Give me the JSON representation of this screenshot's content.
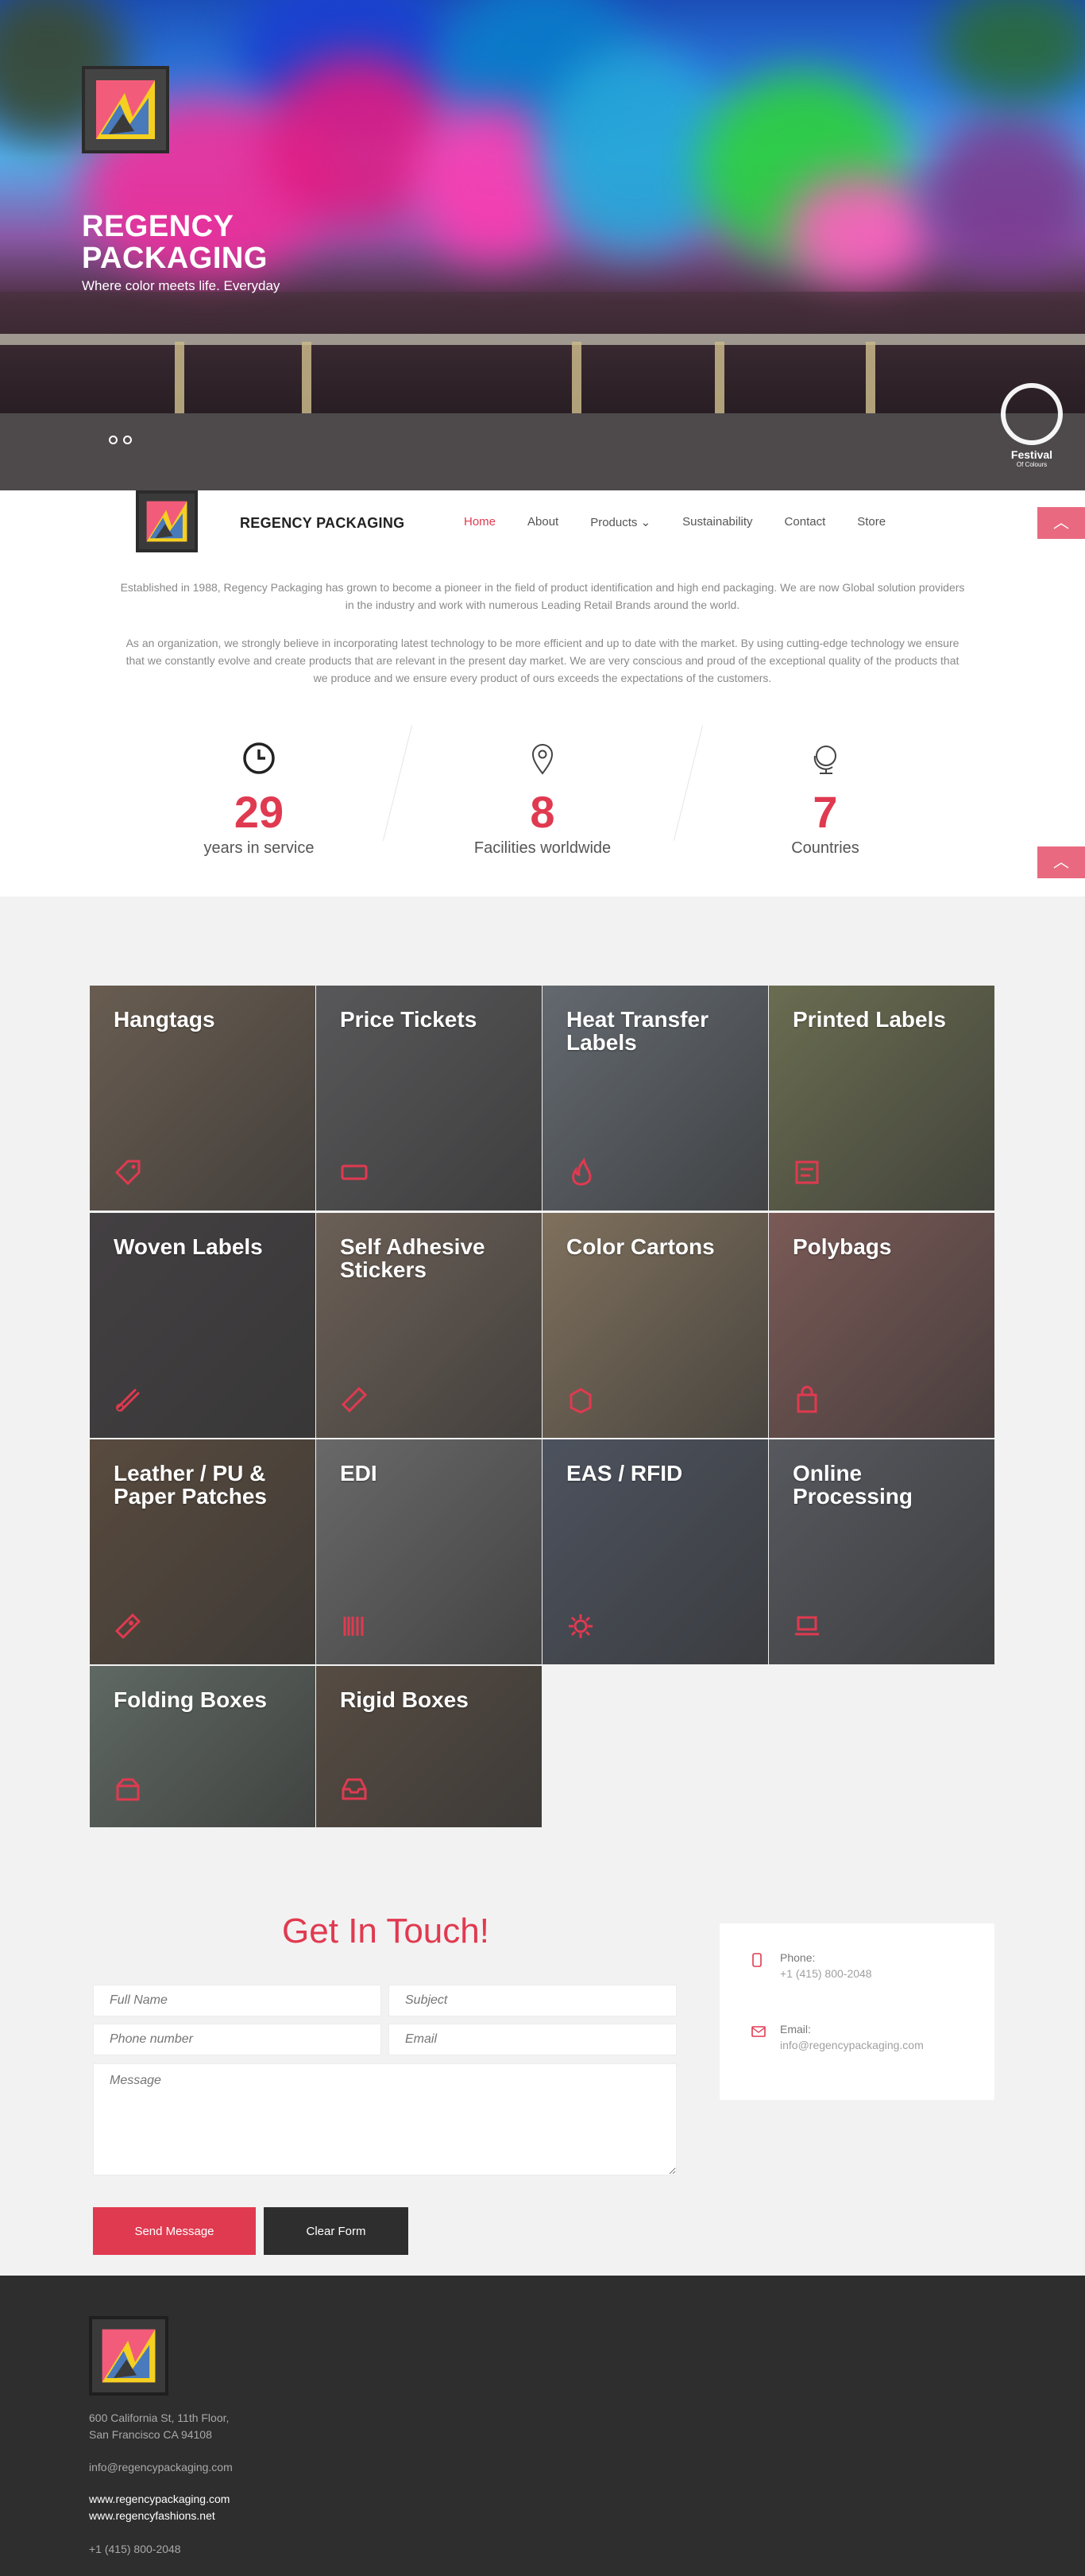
{
  "hero": {
    "title": "REGENCY PACKAGING",
    "subtitle": "Where color meets life. Everyday",
    "festival_title": "Festival",
    "festival_sub": "Of Colours"
  },
  "nav": {
    "brand": "REGENCY PACKAGING",
    "items": [
      {
        "label": "Home",
        "active": true
      },
      {
        "label": "About"
      },
      {
        "label": "Products ⌄"
      },
      {
        "label": "Sustainability"
      },
      {
        "label": "Contact"
      },
      {
        "label": "Store"
      }
    ]
  },
  "about": {
    "p1": "Established in 1988, Regency Packaging has grown to become a pioneer in the field of product identification and high end packaging. We are now Global solution providers in the industry and work with numerous Leading Retail Brands around the world.",
    "p2": "As an organization, we strongly believe in incorporating latest technology to be more efficient and up to date with the market. By using cutting-edge technology we ensure that we constantly evolve and create products that are relevant in the present day market. We are very conscious and proud of the exceptional quality of the products that we produce and we ensure every product of ours exceeds the expectations of the customers."
  },
  "stats": [
    {
      "icon": "clock-icon",
      "value": "29",
      "label": "years in service"
    },
    {
      "icon": "location-pin-icon",
      "value": "8",
      "label": "Facilities worldwide"
    },
    {
      "icon": "globe-icon",
      "value": "7",
      "label": "Countries"
    }
  ],
  "products": [
    {
      "title": "Hangtags",
      "icon": "tag-icon",
      "color": "#8a7560"
    },
    {
      "title": "Price Tickets",
      "icon": "ticket-icon",
      "color": "#6d6d70"
    },
    {
      "title": "Heat Transfer Labels",
      "icon": "fire-icon",
      "color": "#7f8a95"
    },
    {
      "title": "Printed Labels",
      "icon": "label-icon",
      "color": "#8c9160"
    },
    {
      "title": "Woven Labels",
      "icon": "thread-icon",
      "color": "#4a4448"
    },
    {
      "title": "Self Adhesive Stickers",
      "icon": "sticker-icon",
      "color": "#8e7a6a"
    },
    {
      "title": "Color Cartons",
      "icon": "box-icon",
      "color": "#b09775"
    },
    {
      "title": "Polybags",
      "icon": "bag-icon",
      "color": "#a8706a"
    },
    {
      "title": "Leather / PU & Paper Patches",
      "icon": "patch-icon",
      "color": "#6e5640"
    },
    {
      "title": "EDI",
      "icon": "barcode-icon",
      "color": "#8a8a8a"
    },
    {
      "title": "EAS / RFID",
      "icon": "gear-icon",
      "color": "#5a6478"
    },
    {
      "title": "Online Processing",
      "icon": "laptop-icon",
      "color": "#6a6e78"
    },
    {
      "title": "Folding Boxes",
      "icon": "box-open-icon",
      "color": "#7a8a80"
    },
    {
      "title": "Rigid Boxes",
      "icon": "tray-icon",
      "color": "#6a5848"
    }
  ],
  "contact": {
    "heading": "Get In Touch!",
    "placeholders": {
      "full_name": "Full Name",
      "subject": "Subject",
      "phone": "Phone number",
      "email": "Email",
      "message": "Message"
    },
    "send_label": "Send Message",
    "clear_label": "Clear Form",
    "phone_label": "Phone:",
    "phone_value": "+1 (415) 800-2048",
    "email_label": "Email:",
    "email_value": "info@regencypackaging.com"
  },
  "footer": {
    "address1": "600 California St, 11th Floor,",
    "address2": "San Francisco CA 94108",
    "email": "info@regencypackaging.com",
    "site1": "www.regencypackaging.com",
    "site2": "www.regencyfashions.net",
    "phone": "+1 (415) 800-2048"
  },
  "colors": {
    "accent": "#e03a50",
    "scroll_button": "#e96a80",
    "footer_bg": "#2e2e2e"
  }
}
